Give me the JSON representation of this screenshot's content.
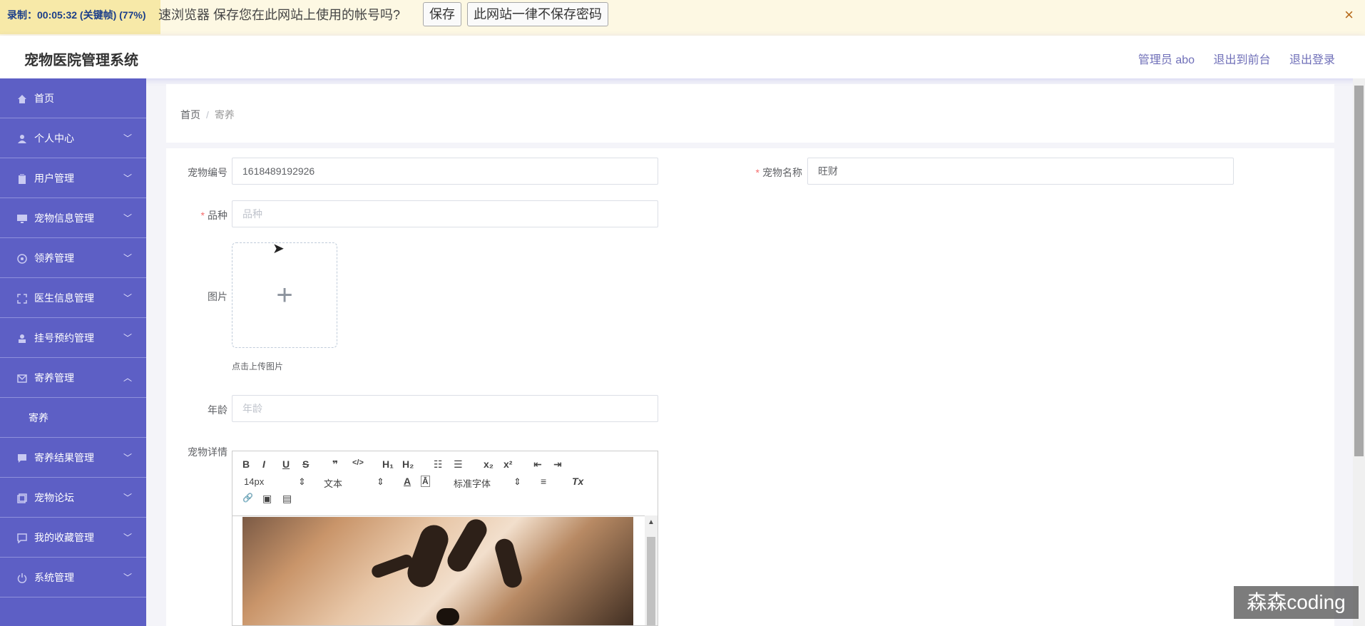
{
  "pwbar": {
    "recording_label": "录制：00:05:32 (关键帧) (77%)",
    "message": "速浏览器 保存您在此网站上使用的帐号吗?",
    "save_label": "保存",
    "never_label": "此网站一律不保存密码",
    "close_icon": "×"
  },
  "header": {
    "title": "宠物医院管理系统",
    "admin_label": "管理员 abo",
    "back_front_label": "退出到前台",
    "logout_label": "退出登录"
  },
  "sidebar": {
    "items": [
      {
        "label": "首页",
        "icon": "home-icon",
        "chevron": ""
      },
      {
        "label": "个人中心",
        "icon": "user-icon",
        "chevron": "﹀"
      },
      {
        "label": "用户管理",
        "icon": "clipboard-icon",
        "chevron": "﹀"
      },
      {
        "label": "宠物信息管理",
        "icon": "monitor-icon",
        "chevron": "﹀"
      },
      {
        "label": "领养管理",
        "icon": "compass-icon",
        "chevron": "﹀"
      },
      {
        "label": "医生信息管理",
        "icon": "frame-icon",
        "chevron": "﹀"
      },
      {
        "label": "挂号预约管理",
        "icon": "person-icon",
        "chevron": "﹀"
      },
      {
        "label": "寄养管理",
        "icon": "mail-icon",
        "chevron": "︿"
      },
      {
        "label": "寄养结果管理",
        "icon": "chat-icon",
        "chevron": "﹀"
      },
      {
        "label": "宠物论坛",
        "icon": "copy-icon",
        "chevron": "﹀"
      },
      {
        "label": "我的收藏管理",
        "icon": "message-icon",
        "chevron": "﹀"
      },
      {
        "label": "系统管理",
        "icon": "power-icon",
        "chevron": "﹀"
      }
    ],
    "sub_item": "寄养"
  },
  "breadcrumb": {
    "home": "首页",
    "separator": "/",
    "current": "寄养"
  },
  "form": {
    "pet_id_label": "宠物编号",
    "pet_id_value": "1618489192926",
    "pet_name_label": "宠物名称",
    "pet_name_value": "旺财",
    "breed_label": "品种",
    "breed_placeholder": "品种",
    "image_label": "图片",
    "upload_plus": "+",
    "upload_tip": "点击上传图片",
    "age_label": "年龄",
    "age_placeholder": "年龄",
    "detail_label": "宠物详情",
    "required_mark": "*"
  },
  "editor": {
    "bold": "B",
    "italic": "I",
    "underline": "U",
    "strike": "S",
    "quote": "❞",
    "code": "</>",
    "h1": "H₁",
    "h2": "H₂",
    "ol": "☷",
    "ul": "☰",
    "sub": "x₂",
    "sup": "x²",
    "outdent": "⇤",
    "indent": "⇥",
    "size_select": "14px",
    "type_select": "文本",
    "font_color": "A",
    "bg_color": "Ā",
    "font_select": "标准字体",
    "align": "≡",
    "clear": "Tx",
    "link": "🔗",
    "image": "▣",
    "video": "▤",
    "select_arrow": "⇕"
  },
  "watermark": "森森coding",
  "colors": {
    "sidebar": "#5d5fc5",
    "accent": "#6f6fb8",
    "required": "#f56c6c"
  }
}
